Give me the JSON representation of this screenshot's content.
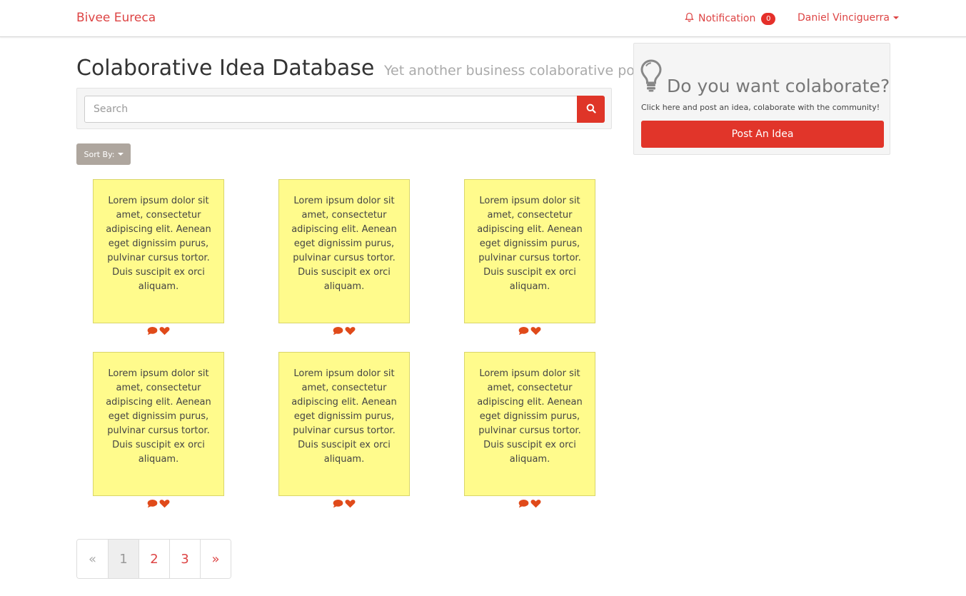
{
  "navbar": {
    "brand": "Bivee Eureca",
    "notification_label": "Notification",
    "notification_count": "0",
    "user_name": "Daniel Vinciguerra"
  },
  "header": {
    "title": "Colaborative Idea Database",
    "subtitle": "Yet another business colaborative portal"
  },
  "search": {
    "placeholder": "Search",
    "value": ""
  },
  "sort": {
    "label": "Sort By:"
  },
  "ideas": [
    {
      "text": "Lorem ipsum dolor sit amet, consectetur adipiscing elit. Aenean eget dignissim purus, pulvinar cursus tortor. Duis suscipit ex orci aliquam."
    },
    {
      "text": "Lorem ipsum dolor sit amet, consectetur adipiscing elit. Aenean eget dignissim purus, pulvinar cursus tortor. Duis suscipit ex orci aliquam."
    },
    {
      "text": "Lorem ipsum dolor sit amet, consectetur adipiscing elit. Aenean eget dignissim purus, pulvinar cursus tortor. Duis suscipit ex orci aliquam."
    },
    {
      "text": "Lorem ipsum dolor sit amet, consectetur adipiscing elit. Aenean eget dignissim purus, pulvinar cursus tortor. Duis suscipit ex orci aliquam."
    },
    {
      "text": "Lorem ipsum dolor sit amet, consectetur adipiscing elit. Aenean eget dignissim purus, pulvinar cursus tortor. Duis suscipit ex orci aliquam."
    },
    {
      "text": "Lorem ipsum dolor sit amet, consectetur adipiscing elit. Aenean eget dignissim purus, pulvinar cursus tortor. Duis suscipit ex orci aliquam."
    }
  ],
  "card_icons": [
    "comment-icon",
    "heart-icon"
  ],
  "pagination": {
    "prev": "«",
    "pages": [
      "1",
      "2",
      "3"
    ],
    "active_page": "1",
    "next": "»"
  },
  "sidebar": {
    "title": "Do you want colaborate?",
    "text": "Click here and post an idea, colaborate with the community!",
    "button_label": "Post An Idea",
    "icon": "lightbulb-icon"
  },
  "colors": {
    "accent": "#dd4444",
    "button_red": "#e1352a",
    "card_yellow": "#fffb8c",
    "sort_gray": "#aea69e"
  }
}
